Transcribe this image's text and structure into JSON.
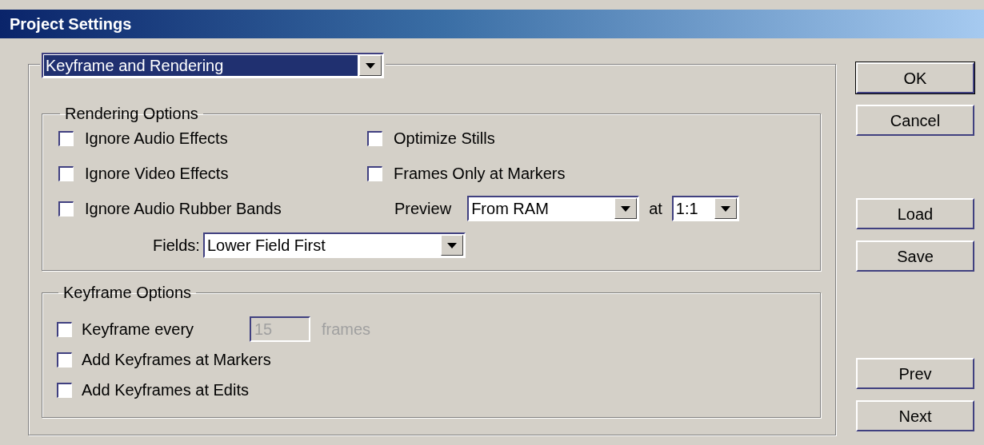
{
  "window": {
    "title": "Project Settings"
  },
  "page_selector": {
    "value": "Keyframe and Rendering",
    "selected": true
  },
  "rendering_options": {
    "title": "Rendering Options",
    "left": [
      {
        "label": "Ignore Audio Effects",
        "checked": false
      },
      {
        "label": "Ignore Video Effects",
        "checked": false
      },
      {
        "label": "Ignore Audio Rubber Bands",
        "checked": false
      }
    ],
    "right": [
      {
        "label": "Optimize Stills",
        "checked": false
      },
      {
        "label": "Frames Only at Markers",
        "checked": false
      }
    ],
    "preview": {
      "label": "Preview",
      "mode": "From RAM",
      "at_label": "at",
      "ratio": "1:1"
    },
    "fields": {
      "label": "Fields:",
      "value": "Lower Field First"
    }
  },
  "keyframe_options": {
    "title": "Keyframe Options",
    "items": [
      {
        "kind": "interval",
        "label": "Keyframe every",
        "checked": false,
        "value": "15",
        "unit": "frames",
        "disabled": true
      },
      {
        "kind": "plain",
        "label": "Add Keyframes at Markers",
        "checked": false
      },
      {
        "kind": "plain",
        "label": "Add Keyframes at Edits",
        "checked": false
      }
    ]
  },
  "button_groups": [
    [
      {
        "label": "OK",
        "default": true
      },
      {
        "label": "Cancel",
        "default": false
      }
    ],
    [
      {
        "label": "Load",
        "default": false
      },
      {
        "label": "Save",
        "default": false
      }
    ],
    [
      {
        "label": "Prev",
        "default": false
      },
      {
        "label": "Next",
        "default": false
      }
    ]
  ]
}
